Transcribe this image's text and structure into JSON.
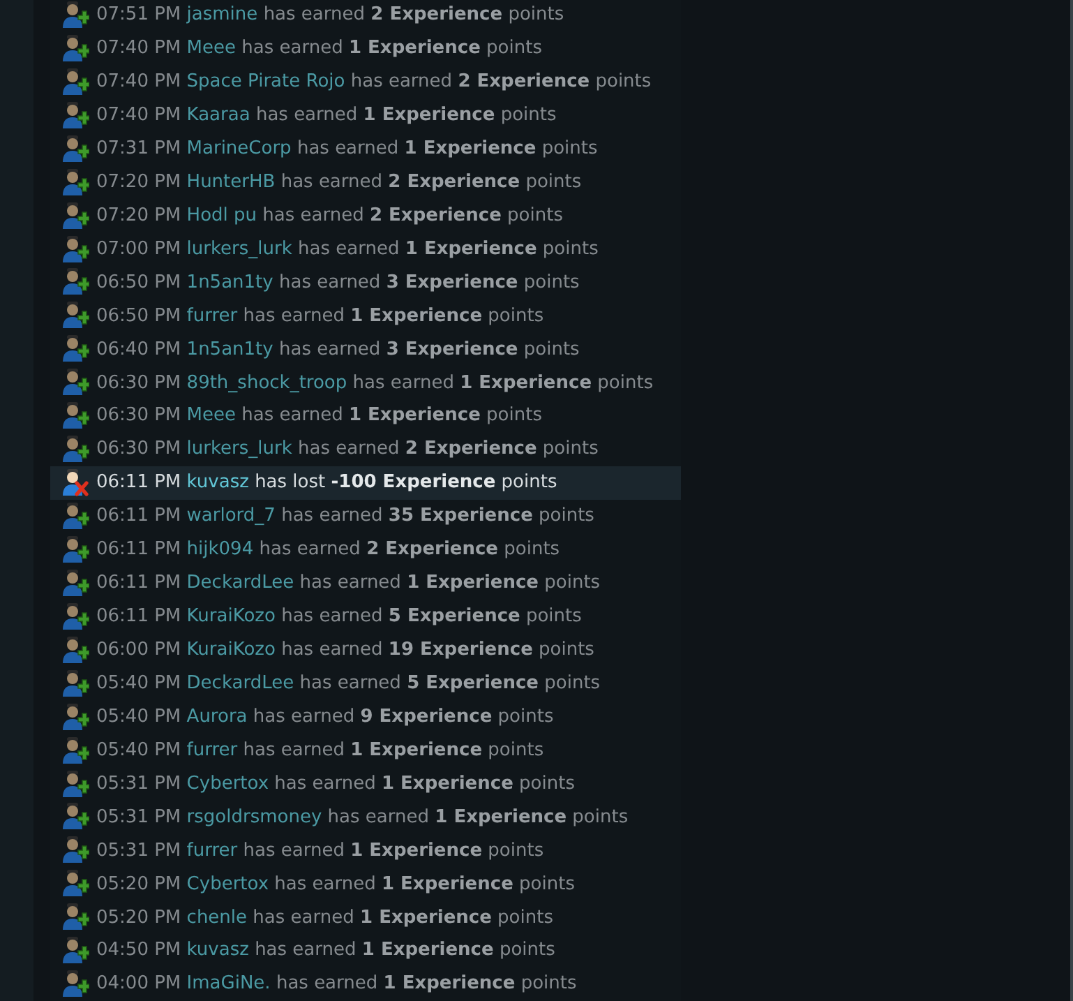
{
  "log": [
    {
      "kind": "earned",
      "time": "07:51 PM",
      "user": "jasmine",
      "text": "has earned **2 Experience** points",
      "selected": false
    },
    {
      "kind": "earned",
      "time": "07:40 PM",
      "user": "Meee",
      "text": "has earned **1 Experience** points",
      "selected": false
    },
    {
      "kind": "earned",
      "time": "07:40 PM",
      "user": "Space Pirate Rojo",
      "text": "has earned **2 Experience** points",
      "selected": false
    },
    {
      "kind": "earned",
      "time": "07:40 PM",
      "user": "Kaaraa",
      "text": "has earned **1 Experience** points",
      "selected": false
    },
    {
      "kind": "earned",
      "time": "07:31 PM",
      "user": "MarineCorp",
      "text": "has earned **1 Experience** points",
      "selected": false
    },
    {
      "kind": "earned",
      "time": "07:20 PM",
      "user": "HunterHB",
      "text": "has earned **2 Experience** points",
      "selected": false
    },
    {
      "kind": "earned",
      "time": "07:20 PM",
      "user": "Hodl pu",
      "text": "has earned **2 Experience** points",
      "selected": false
    },
    {
      "kind": "earned",
      "time": "07:00 PM",
      "user": "lurkers_lurk",
      "text": "has earned **1 Experience** points",
      "selected": false
    },
    {
      "kind": "earned",
      "time": "06:50 PM",
      "user": "1n5an1ty",
      "text": "has earned **3 Experience** points",
      "selected": false
    },
    {
      "kind": "earned",
      "time": "06:50 PM",
      "user": "furrer",
      "text": "has earned **1 Experience** points",
      "selected": false
    },
    {
      "kind": "earned",
      "time": "06:40 PM",
      "user": "1n5an1ty",
      "text": "has earned **3 Experience** points",
      "selected": false
    },
    {
      "kind": "earned",
      "time": "06:30 PM",
      "user": "89th_shock_troop",
      "text": "has earned **1 Experience** points",
      "selected": false
    },
    {
      "kind": "earned",
      "time": "06:30 PM",
      "user": "Meee",
      "text": "has earned **1 Experience** points",
      "selected": false
    },
    {
      "kind": "earned",
      "time": "06:30 PM",
      "user": "lurkers_lurk",
      "text": "has earned **2 Experience** points",
      "selected": false
    },
    {
      "kind": "lost",
      "time": "06:11 PM",
      "user": "kuvasz",
      "text": "has lost **-100 Experience** points",
      "selected": true
    },
    {
      "kind": "earned",
      "time": "06:11 PM",
      "user": "warlord_7",
      "text": "has earned **35 Experience** points",
      "selected": false
    },
    {
      "kind": "earned",
      "time": "06:11 PM",
      "user": "hijk094",
      "text": "has earned **2 Experience** points",
      "selected": false
    },
    {
      "kind": "earned",
      "time": "06:11 PM",
      "user": "DeckardLee",
      "text": "has earned **1 Experience** points",
      "selected": false
    },
    {
      "kind": "earned",
      "time": "06:11 PM",
      "user": "KuraiKozo",
      "text": "has earned **5 Experience** points",
      "selected": false
    },
    {
      "kind": "earned",
      "time": "06:00 PM",
      "user": "KuraiKozo",
      "text": "has earned **19 Experience** points",
      "selected": false
    },
    {
      "kind": "earned",
      "time": "05:40 PM",
      "user": "DeckardLee",
      "text": "has earned **5 Experience** points",
      "selected": false
    },
    {
      "kind": "earned",
      "time": "05:40 PM",
      "user": "Aurora",
      "text": "has earned **9 Experience** points",
      "selected": false
    },
    {
      "kind": "earned",
      "time": "05:40 PM",
      "user": "furrer",
      "text": "has earned **1 Experience** points",
      "selected": false
    },
    {
      "kind": "earned",
      "time": "05:31 PM",
      "user": "Cybertox",
      "text": "has earned **1 Experience** points",
      "selected": false
    },
    {
      "kind": "earned",
      "time": "05:31 PM",
      "user": "rsgoldrsmoney",
      "text": "has earned **1 Experience** points",
      "selected": false
    },
    {
      "kind": "earned",
      "time": "05:31 PM",
      "user": "furrer",
      "text": "has earned **1 Experience** points",
      "selected": false
    },
    {
      "kind": "earned",
      "time": "05:20 PM",
      "user": "Cybertox",
      "text": "has earned **1 Experience** points",
      "selected": false
    },
    {
      "kind": "earned",
      "time": "05:20 PM",
      "user": "chenle",
      "text": "has earned **1 Experience** points",
      "selected": false
    },
    {
      "kind": "earned",
      "time": "04:50 PM",
      "user": "kuvasz",
      "text": "has earned **1 Experience** points",
      "selected": false
    },
    {
      "kind": "earned",
      "time": "04:00 PM",
      "user": "ImaGiNe.",
      "text": "has earned **1 Experience** points",
      "selected": false
    }
  ]
}
